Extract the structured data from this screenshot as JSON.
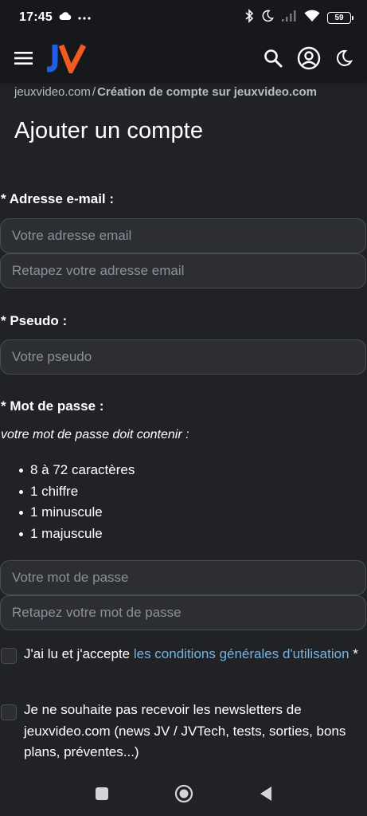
{
  "status_bar": {
    "time": "17:45",
    "battery": "59",
    "icons": [
      "cloud-icon",
      "more-dots-icon",
      "bluetooth-icon",
      "moon-icon",
      "signal-icon",
      "wifi-icon",
      "battery-icon"
    ]
  },
  "header": {
    "logo_text": "JV",
    "icons": [
      "menu-icon",
      "search-icon",
      "account-icon",
      "dark-mode-icon"
    ],
    "colors": {
      "logo_blue": "#1f5ee8",
      "logo_orange": "#f25a1f"
    }
  },
  "breadcrumb": {
    "home": "jeuxvideo.com",
    "separator": "/",
    "current": "Création de compte sur jeuxvideo.com"
  },
  "page_title": "Ajouter un compte",
  "email": {
    "label": "* Adresse e-mail :",
    "placeholder": "Votre adresse email",
    "confirm_placeholder": "Retapez votre adresse email",
    "value": "",
    "confirm_value": ""
  },
  "pseudo": {
    "label": "* Pseudo :",
    "placeholder": "Votre pseudo",
    "value": ""
  },
  "password": {
    "label": "* Mot de passe :",
    "hint": "votre mot de passe doit contenir :",
    "rules": [
      "8 à 72 caractères",
      "1 chiffre",
      "1 minuscule",
      "1 majuscule"
    ],
    "placeholder": "Votre mot de passe",
    "confirm_placeholder": "Retapez votre mot de passe",
    "value": "",
    "confirm_value": ""
  },
  "terms": {
    "text_before": "J'ai lu et j'accepte ",
    "link": "les conditions générales d'utilisation",
    "text_after": " *",
    "checked": false
  },
  "newsletter": {
    "text": "Je ne souhaite pas recevoir les newsletters de jeuxvideo.com (news JV / JVTech, tests, sorties, bons plans, préventes...)",
    "checked": false
  },
  "nav_bar": {
    "icons": [
      "recent-apps-icon",
      "home-icon",
      "back-icon"
    ]
  }
}
